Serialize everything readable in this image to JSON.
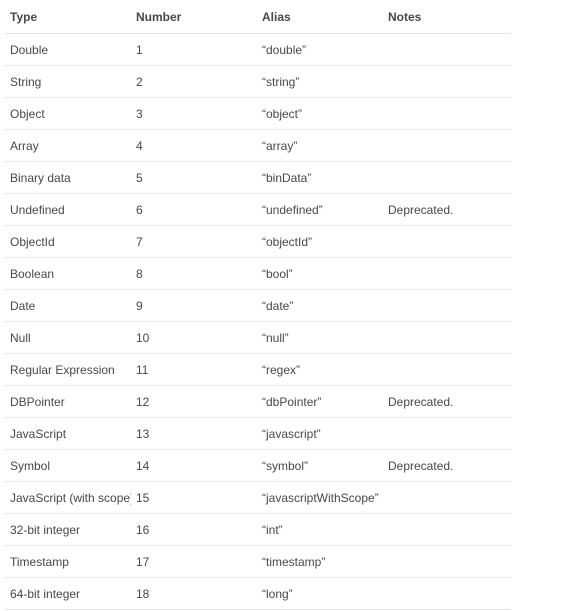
{
  "table": {
    "headers": [
      "Type",
      "Number",
      "Alias",
      "Notes"
    ],
    "rows": [
      [
        "Double",
        "1",
        "“double”",
        ""
      ],
      [
        "String",
        "2",
        "“string”",
        ""
      ],
      [
        "Object",
        "3",
        "“object”",
        ""
      ],
      [
        "Array",
        "4",
        "“array”",
        ""
      ],
      [
        "Binary data",
        "5",
        "“binData”",
        ""
      ],
      [
        "Undefined",
        "6",
        "“undefined”",
        "Deprecated."
      ],
      [
        "ObjectId",
        "7",
        "“objectId”",
        ""
      ],
      [
        "Boolean",
        "8",
        "“bool”",
        ""
      ],
      [
        "Date",
        "9",
        "“date”",
        ""
      ],
      [
        "Null",
        "10",
        "“null”",
        ""
      ],
      [
        "Regular Expression",
        "11",
        "“regex”",
        ""
      ],
      [
        "DBPointer",
        "12",
        "“dbPointer”",
        "Deprecated."
      ],
      [
        "JavaScript",
        "13",
        "“javascript”",
        ""
      ],
      [
        "Symbol",
        "14",
        "“symbol”",
        "Deprecated."
      ],
      [
        "JavaScript (with scope)",
        "15",
        "“javascriptWithScope”",
        ""
      ],
      [
        "32-bit integer",
        "16",
        "“int”",
        ""
      ],
      [
        "Timestamp",
        "17",
        "“timestamp”",
        ""
      ],
      [
        "64-bit integer",
        "18",
        "“long”",
        ""
      ]
    ]
  }
}
